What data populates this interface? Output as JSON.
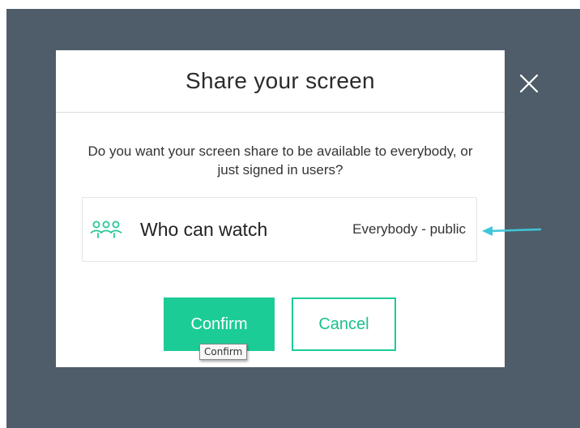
{
  "colors": {
    "backdrop": "#4f5d6a",
    "modal_background": "#ffffff",
    "accent_green": "#1ccc96",
    "cancel_text": "#1bbf8d",
    "arrow": "#3fc6d8",
    "icon_green": "#2bc79a"
  },
  "modal": {
    "title": "Share your screen",
    "prompt": "Do you want your screen share to be available to everybody, or just signed in users?",
    "close_icon": "close-icon"
  },
  "setting": {
    "icon": "people-icon",
    "label": "Who can watch",
    "value": "Everybody - public"
  },
  "annotation": {
    "icon": "arrow-left-icon"
  },
  "buttons": {
    "confirm_label": "Confirm",
    "cancel_label": "Cancel"
  },
  "tooltip": {
    "text": "Confirm"
  }
}
